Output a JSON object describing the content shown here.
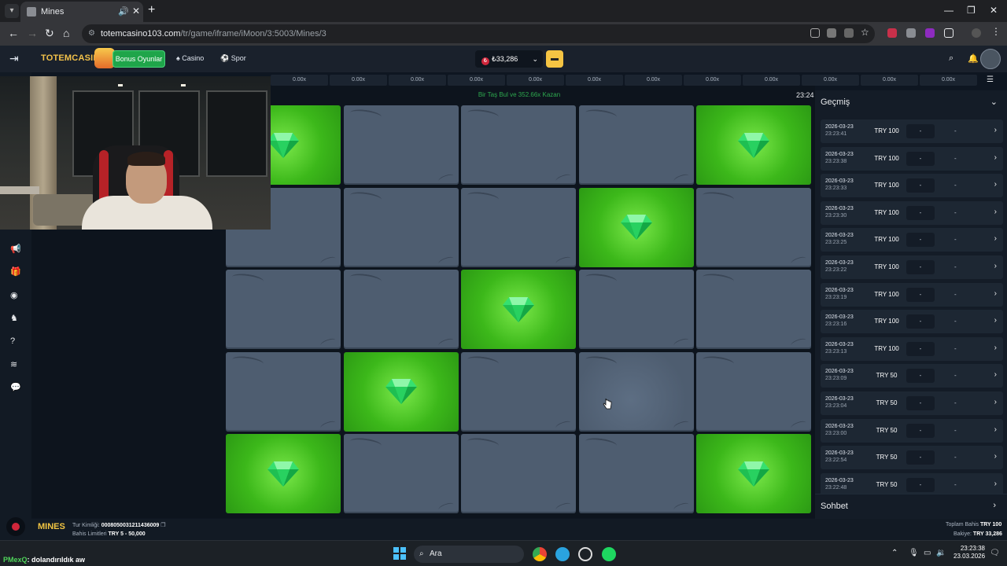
{
  "browser": {
    "tab_title": "Mines",
    "url_host": "totemcasino103.com",
    "url_path": "/tr/game/iframe/iMoon/3:5003/Mines/3"
  },
  "header": {
    "logo": "TOTEMCASINO",
    "bonus_label": "Bonus Oyunlar",
    "casino_label": "Casino",
    "sport_label": "Spor",
    "balance": "₺33,286"
  },
  "game": {
    "multipliers": [
      "0.00x",
      "0.00x",
      "0.00x",
      "0.00x",
      "0.00x",
      "0.00x",
      "0.00x",
      "0.00x",
      "0.00x",
      "0.00x",
      "0.00x",
      "0.00x"
    ],
    "hint": "Bir Taş Bul ve 352.66x Kazan",
    "clock": "23:24",
    "grid": [
      [
        "gem",
        "tile",
        "tile",
        "tile",
        "gem"
      ],
      [
        "tile",
        "tile",
        "tile",
        "gem",
        "tile"
      ],
      [
        "tile",
        "tile",
        "gem",
        "tile",
        "tile"
      ],
      [
        "tile",
        "gem",
        "tile",
        "tile",
        "tile"
      ],
      [
        "gem",
        "tile",
        "tile",
        "tile",
        "gem"
      ]
    ]
  },
  "history": {
    "title": "Geçmiş",
    "rows": [
      {
        "date": "2026-03-23",
        "time": "23:23:41",
        "amount": "TRY 100",
        "c1": "-",
        "c2": "-"
      },
      {
        "date": "2026-03-23",
        "time": "23:23:38",
        "amount": "TRY 100",
        "c1": "-",
        "c2": "-"
      },
      {
        "date": "2026-03-23",
        "time": "23:23:33",
        "amount": "TRY 100",
        "c1": "-",
        "c2": "-"
      },
      {
        "date": "2026-03-23",
        "time": "23:23:30",
        "amount": "TRY 100",
        "c1": "-",
        "c2": "-"
      },
      {
        "date": "2026-03-23",
        "time": "23:23:25",
        "amount": "TRY 100",
        "c1": "-",
        "c2": "-"
      },
      {
        "date": "2026-03-23",
        "time": "23:23:22",
        "amount": "TRY 100",
        "c1": "-",
        "c2": "-"
      },
      {
        "date": "2026-03-23",
        "time": "23:23:19",
        "amount": "TRY 100",
        "c1": "-",
        "c2": "-"
      },
      {
        "date": "2026-03-23",
        "time": "23:23:16",
        "amount": "TRY 100",
        "c1": "-",
        "c2": "-"
      },
      {
        "date": "2026-03-23",
        "time": "23:23:13",
        "amount": "TRY 100",
        "c1": "-",
        "c2": "-"
      },
      {
        "date": "2026-03-23",
        "time": "23:23:09",
        "amount": "TRY 50",
        "c1": "-",
        "c2": "-"
      },
      {
        "date": "2026-03-23",
        "time": "23:23:04",
        "amount": "TRY 50",
        "c1": "-",
        "c2": "-"
      },
      {
        "date": "2026-03-23",
        "time": "23:23:00",
        "amount": "TRY 50",
        "c1": "-",
        "c2": "-"
      },
      {
        "date": "2026-03-23",
        "time": "23:22:54",
        "amount": "TRY 50",
        "c1": "-",
        "c2": "-"
      },
      {
        "date": "2026-03-23",
        "time": "23:22:48",
        "amount": "TRY 50",
        "c1": "-",
        "c2": "-"
      }
    ],
    "chat_label": "Sohbet"
  },
  "footer": {
    "game_logo": "MINES",
    "round_label": "Tur Kimliği:",
    "round_id": "0008050031211436009",
    "limits_label": "Bahis Limitleri",
    "limits": "TRY 5 - 50,000",
    "total_bet_label": "Toplam Bahis",
    "total_bet": "TRY 100",
    "balance_label": "Bakiye:",
    "balance": "TRY 33,286"
  },
  "taskbar": {
    "chat_user": "PMexQ",
    "chat_text": ": dolandırıldık aw",
    "search_label": "Ara",
    "time": "23:23:38",
    "date": "23.03.2026"
  },
  "colors": {
    "gem_tile": "#3cb81a",
    "stone_tile": "#4e5d70",
    "bonus_button": "#1fa54a",
    "wallet_button": "#f5c443"
  }
}
